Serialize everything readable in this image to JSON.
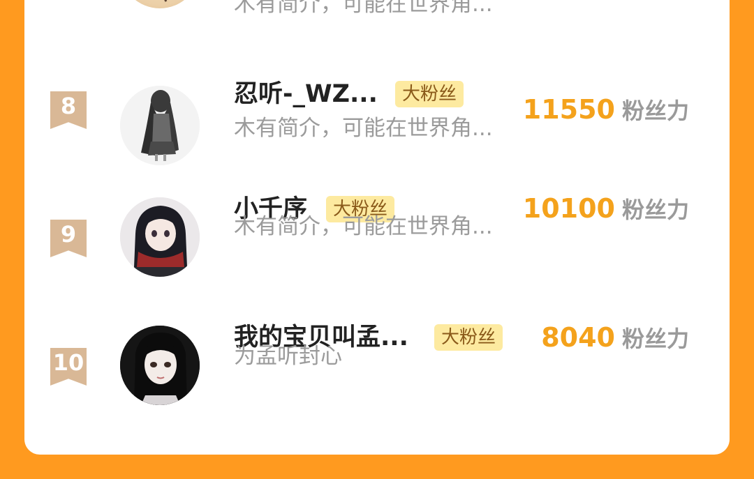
{
  "partial_row": {
    "bio": "木有简介，可能在世界角..."
  },
  "rows": [
    {
      "rank": "8",
      "name": "忍听-_WZ...",
      "badge": "大粉丝",
      "bio": "木有简介，可能在世界角...",
      "score": "11550",
      "score_label": "粉丝力",
      "avatar_icon": "avatar-girl-gray-icon"
    },
    {
      "rank": "9",
      "name": "小千序",
      "badge": "大粉丝",
      "bio": "木有简介，可能在世界角...",
      "score": "10100",
      "score_label": "粉丝力",
      "avatar_icon": "avatar-girl-scarf-icon"
    },
    {
      "rank": "10",
      "name": "我的宝贝叫孟...",
      "badge": "大粉丝",
      "bio": "为孟听封心",
      "score": "8040",
      "score_label": "粉丝力",
      "avatar_icon": "avatar-girl-dark-icon"
    }
  ],
  "colors": {
    "background": "#ff9a1f",
    "score": "#f4a21c",
    "rank_flag": "#d9b896",
    "badge_bg": "#fdeaa0"
  }
}
